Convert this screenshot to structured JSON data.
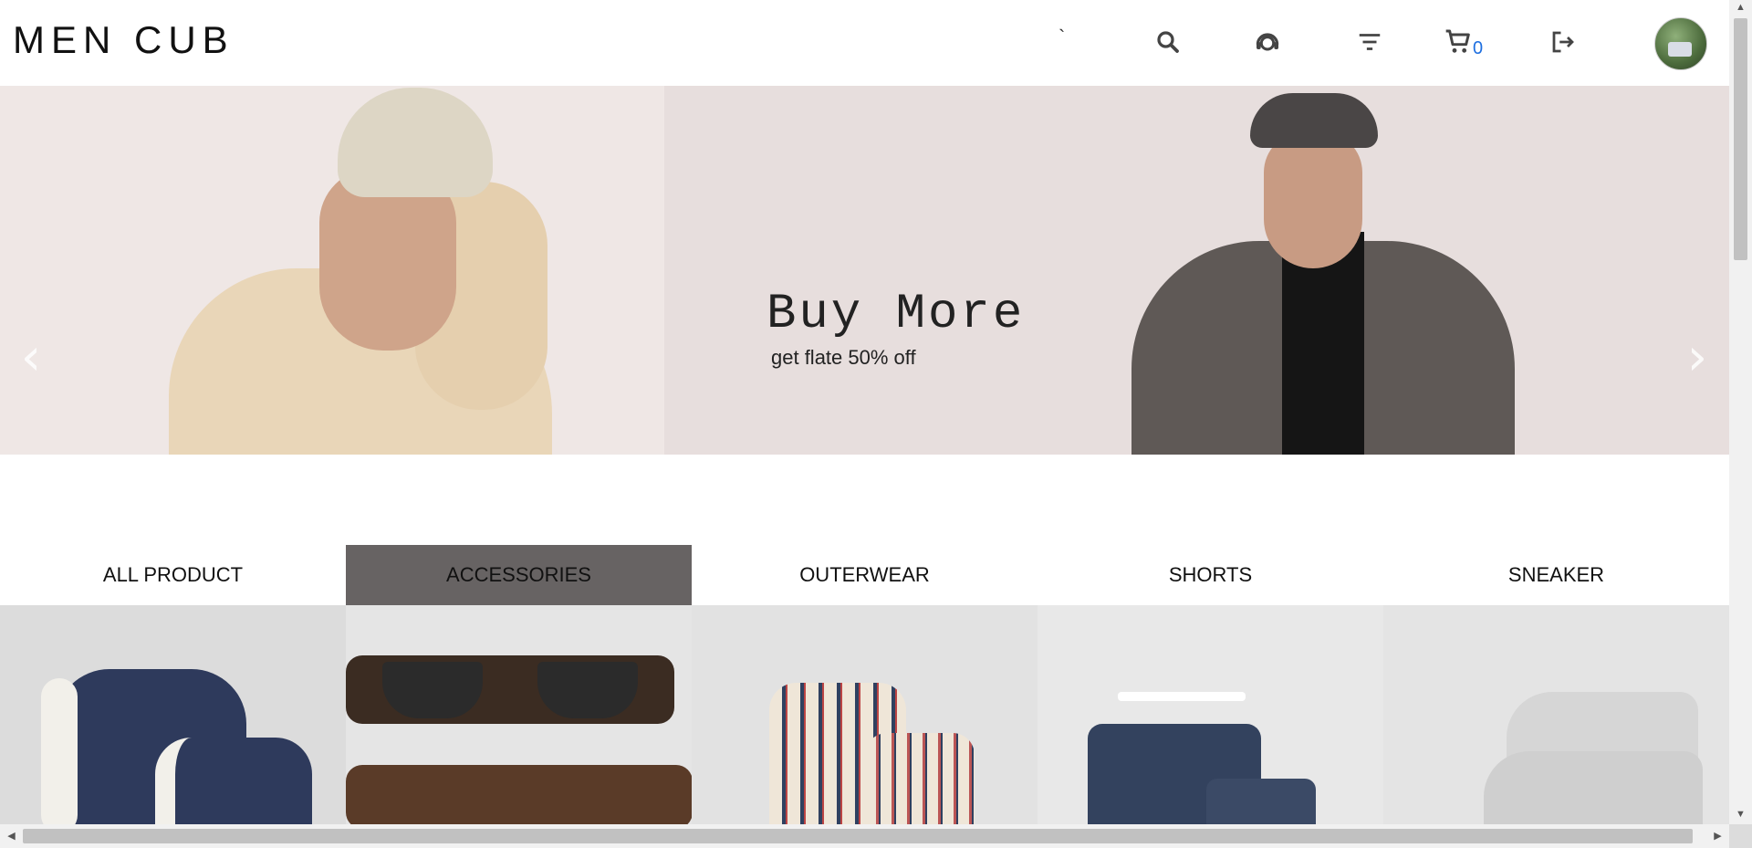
{
  "header": {
    "logo": "MEN CUB",
    "tick": "`",
    "icons": [
      "search-icon",
      "support-agent-icon",
      "filter-icon",
      "cart-icon",
      "logout-icon"
    ],
    "cart_count": "0",
    "avatar": "user-avatar"
  },
  "hero": {
    "title": "Buy More",
    "subtitle": "get flate 50% off",
    "prev_icon": "chevron-left-icon",
    "next_icon": "chevron-right-icon"
  },
  "tabs": [
    {
      "label": "ALL PRODUCT",
      "active": false
    },
    {
      "label": "ACCESSORIES",
      "active": true
    },
    {
      "label": "OUTERWEAR",
      "active": false
    },
    {
      "label": "SHORTS",
      "active": false
    },
    {
      "label": "SNEAKER",
      "active": false
    }
  ],
  "colors": {
    "accent": "#1e6fe0",
    "active_tab": "#676363",
    "hero_bg": "#e7dedd"
  }
}
